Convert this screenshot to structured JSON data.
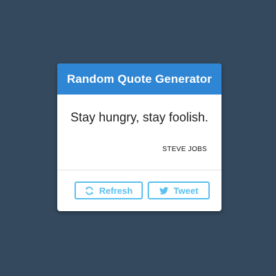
{
  "header": {
    "title": "Random Quote Generator"
  },
  "quote": {
    "text": "Stay hungry, stay foolish.",
    "author": "STEVE JOBS"
  },
  "actions": {
    "refresh_label": "Refresh",
    "refresh_icon": "refresh-icon",
    "tweet_label": "Tweet",
    "tweet_icon": "twitter-icon"
  },
  "colors": {
    "background": "#34495e",
    "header": "#2e86d4",
    "button_accent": "#5bc0f0"
  }
}
